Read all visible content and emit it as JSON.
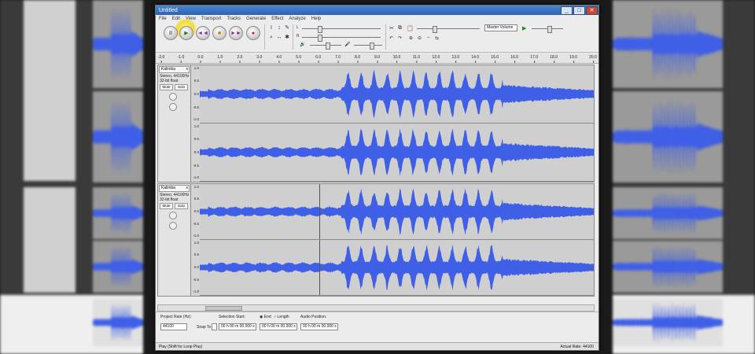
{
  "window": {
    "title": "Untitled",
    "min": "_",
    "max": "□",
    "close": "✕"
  },
  "menu": [
    "File",
    "Edit",
    "View",
    "Transport",
    "Tracks",
    "Generate",
    "Effect",
    "Analyze",
    "Help"
  ],
  "transport": {
    "pause": "II",
    "play": "▶",
    "loop": "◄◄",
    "stop": "■",
    "skip_end": "►►",
    "record": "●"
  },
  "tools": {
    "selection": "I",
    "envelope": "↕",
    "draw": "✎",
    "zoom": "⌕",
    "timeshift": "↔",
    "multi": "✱"
  },
  "meters": {
    "output": "L",
    "input": "R",
    "mic": "🎤",
    "speaker": "🔊"
  },
  "device": {
    "output_device": "Master Volume"
  },
  "ruler_ticks": [
    "-2.0",
    "-1.0",
    "0.0",
    "1.0",
    "2.0",
    "3.0",
    "4.0",
    "5.0",
    "6.0",
    "7.0",
    "8.0",
    "9.0",
    "10.0",
    "11.0",
    "12.0",
    "13.0",
    "14.0",
    "15.0",
    "16.0",
    "17.0",
    "18.0",
    "19.0",
    "20.0"
  ],
  "track1": {
    "name": "Kalimba",
    "close": "x",
    "info1": "Stereo, 44100Hz",
    "info2": "32-bit float",
    "mute": "Mute",
    "solo": "Solo",
    "scale": [
      "1.0",
      "0.5",
      "0.0",
      "-0.5",
      "-1.0"
    ]
  },
  "track2": {
    "name": "Kalimba",
    "close": "x",
    "info1": "Stereo, 44100Hz",
    "info2": "32-bit float",
    "mute": "Mute",
    "solo": "Solo",
    "scale": [
      "1.0",
      "0.5",
      "0.0",
      "-0.5",
      "-1.0"
    ]
  },
  "selection": {
    "project_rate_label": "Project Rate (Hz):",
    "project_rate": "44100",
    "snap_label": "Snap To",
    "start_label": "Selection Start:",
    "start_value": "00 h 00 m 00.000 s",
    "end_label": "End",
    "length_label": "Length",
    "end_value": "00 h 00 m 00.000 s",
    "pos_label": "Audio Position:",
    "pos_value": "00 h 00 m 00.000 s"
  },
  "status": {
    "left": "Play (Shift for Loop Play)",
    "right": "Actual Rate: 44100"
  },
  "colors": {
    "waveform": "#3f5fe6",
    "titlebar": "#2a62b4",
    "highlight": "#f2dc33"
  }
}
